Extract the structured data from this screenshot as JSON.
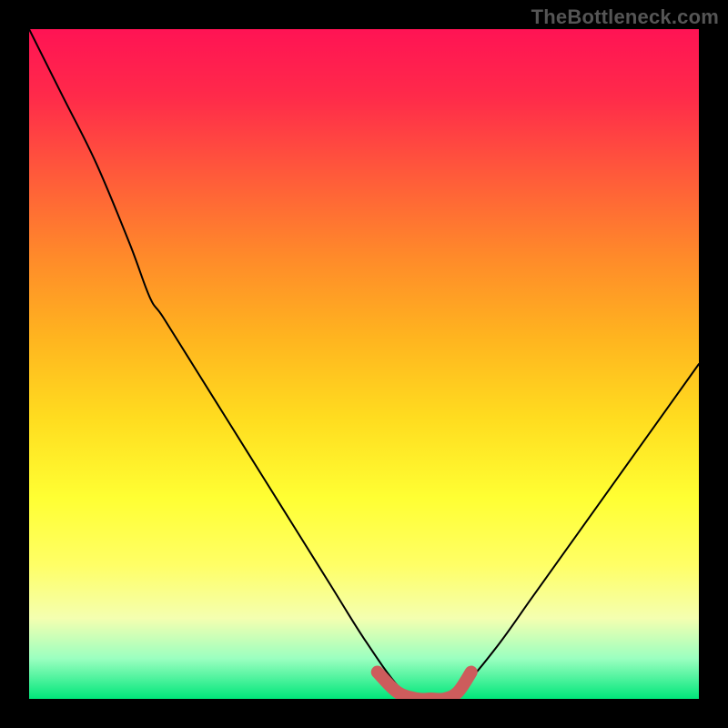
{
  "watermark": "TheBottleneck.com",
  "chart_data": {
    "type": "line",
    "title": "",
    "xlabel": "",
    "ylabel": "",
    "xlim": [
      0,
      100
    ],
    "ylim": [
      0,
      100
    ],
    "series": [
      {
        "name": "bottleneck-curve",
        "x": [
          0,
          5,
          10,
          15,
          18,
          20,
          25,
          30,
          35,
          40,
          45,
          50,
          55,
          58,
          62,
          65,
          70,
          75,
          80,
          85,
          90,
          95,
          100
        ],
        "y": [
          100,
          90,
          80,
          68,
          60,
          57,
          49,
          41,
          33,
          25,
          17,
          9,
          2,
          0,
          0,
          2,
          8,
          15,
          22,
          29,
          36,
          43,
          50
        ]
      }
    ],
    "accent_segment": {
      "name": "optimal-range",
      "color": "#cd5c5c",
      "x": [
        52,
        55,
        58,
        60,
        62,
        64,
        66
      ],
      "y": [
        4,
        1,
        0,
        0,
        0,
        1,
        4
      ]
    },
    "gradient": {
      "top": "#ff1354",
      "bottom": "#00e67a"
    }
  }
}
